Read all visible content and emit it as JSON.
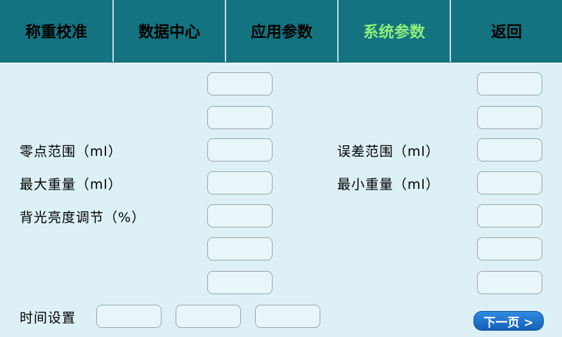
{
  "tabs": [
    {
      "label": "称重校准"
    },
    {
      "label": "数据中心"
    },
    {
      "label": "应用参数"
    },
    {
      "label": "系统参数",
      "active": true
    },
    {
      "label": "返回"
    }
  ],
  "labels": {
    "zero_range": "零点范围（ml）",
    "max_weight": "最大重量（ml）",
    "backlight": "背光亮度调节（%）",
    "error_range": "误差范围（ml）",
    "min_weight": "最小重量（ml）",
    "time_setting": "时间设置"
  },
  "buttons": {
    "next_page": "下一页 >"
  },
  "fields": {
    "left": [
      "",
      "",
      "",
      "",
      "",
      "",
      ""
    ],
    "right": [
      "",
      "",
      "",
      "",
      "",
      "",
      ""
    ],
    "time": [
      "",
      "",
      ""
    ]
  },
  "colors": {
    "header_bg": "#13737f",
    "active_tab": "#8ff07a",
    "page_bg": "#dcf0f6",
    "button_blue": "#1a6fc8"
  }
}
